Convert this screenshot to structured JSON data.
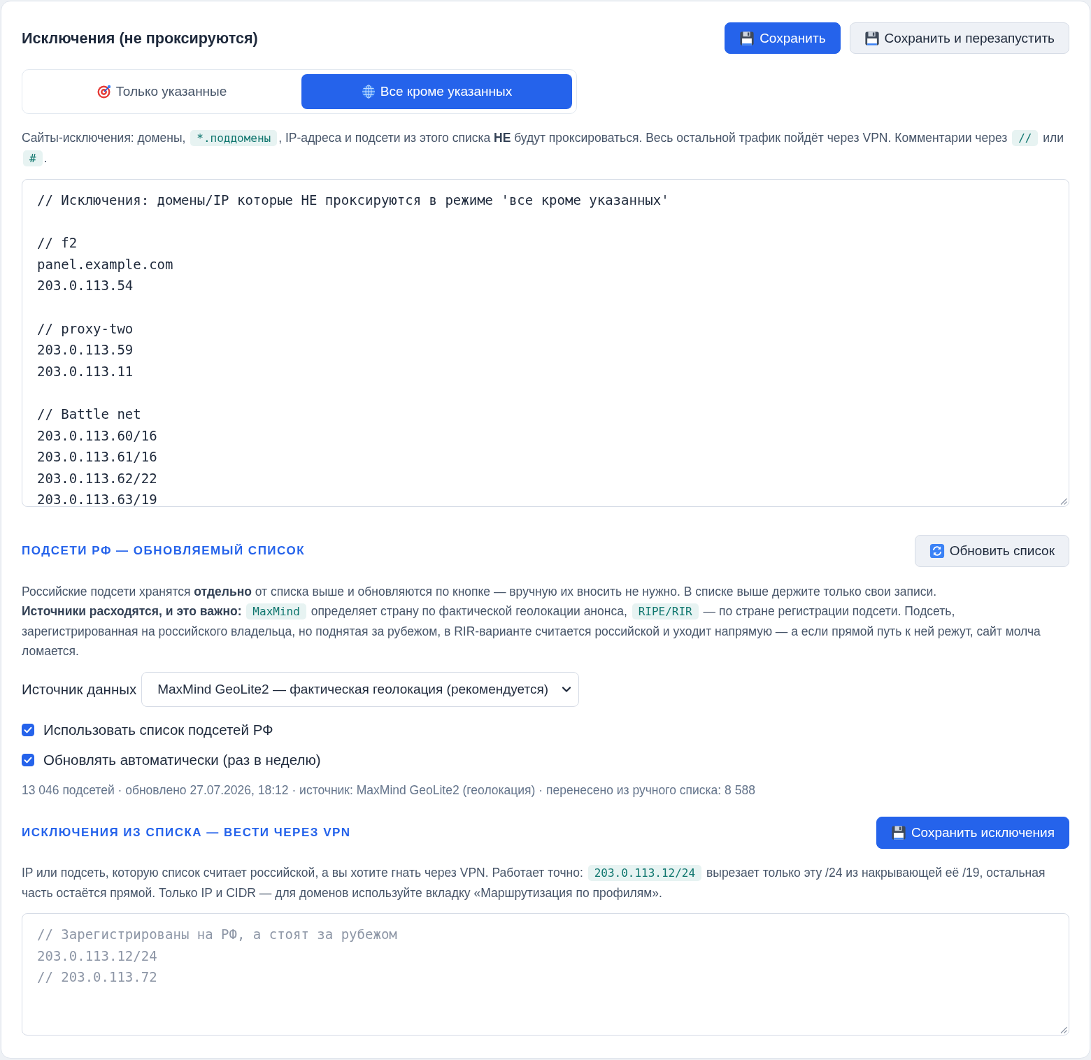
{
  "header": {
    "title": "Исключения (не проксируются)",
    "buttons": [
      {
        "label": "Сохранить",
        "kind": "primary"
      },
      {
        "label": "Сохранить и перезапустить",
        "kind": "secondary"
      }
    ]
  },
  "mode_tabs": [
    {
      "label": "Только указанные",
      "selected": false
    },
    {
      "label": "Все кроме указанных",
      "selected": true
    }
  ],
  "description": [
    {
      "kind": "text",
      "text": "Сайты-исключения: домены, "
    },
    {
      "kind": "code",
      "text": "*.поддомены"
    },
    {
      "kind": "text",
      "text": ", IP-адреса и подсети из этого списка **НЕ** будут проксироваться. Весь остальной трафик пойдёт через VPN. Комментарии через "
    },
    {
      "kind": "code",
      "text": "//"
    },
    {
      "kind": "text",
      "text": " или "
    },
    {
      "kind": "code",
      "text": "#"
    },
    {
      "kind": "text",
      "text": "."
    }
  ],
  "exclusions_editor": {
    "value": "// Исключения: домены/IP которые НЕ проксируются в режиме 'все кроме указанных'\n\n// f2\npanel.example.com\n203.0.113.54\n\n// proxy-two\n203.0.113.59\n203.0.113.11\n\n// Battle net\n203.0.113.60/16\n203.0.113.61/16\n203.0.113.62/22\n203.0.113.63/19"
  },
  "ru_subnets": {
    "heading": "ПОДСЕТИ РФ — ОБНОВЛЯЕМЫЙ СПИСОК",
    "button": {
      "label": "Обновить список",
      "kind": "secondary"
    },
    "paragraphs": [
      [
        {
          "kind": "text",
          "text": "Российские подсети хранятся **отдельно** от списка выше и обновляются по кнопке — вручную их вносить не нужно. В списке выше держите только свои записи."
        }
      ],
      [
        {
          "kind": "text",
          "text": "**Источники расходятся, и это важно:** "
        },
        {
          "kind": "code",
          "text": "MaxMind"
        },
        {
          "kind": "text",
          "text": " определяет страну по фактической геолокации анонса, "
        },
        {
          "kind": "code",
          "text": "RIPE/RIR"
        },
        {
          "kind": "text",
          "text": " — по стране регистрации подсети. Подсеть, зарегистрированная на российского владельца, но поднятая за рубежом, в RIR-варианте считается российской и уходит напрямую — а если прямой путь к ней режут, сайт молча ломается."
        }
      ]
    ],
    "source_select": {
      "label": "Источник данных",
      "value": "MaxMind GeoLite2 — фактическая геолокация (рекомендуется)"
    },
    "checkboxes": [
      {
        "label": "Использовать список подсетей РФ",
        "checked": true
      },
      {
        "label": "Обновлять автоматически (раз в неделю)",
        "checked": true
      }
    ],
    "status": "13 046 подсетей · обновлено 27.07.2026, 18:12 · источник: MaxMind GeoLite2 (геолокация) · перенесено из ручного списка: 8 588"
  },
  "vpn_exceptions": {
    "heading": "ИСКЛЮЧЕНИЯ ИЗ СПИСКА — ВЕСТИ ЧЕРЕЗ VPN",
    "button": {
      "label": "Сохранить исключения",
      "kind": "primary"
    },
    "paragraph": [
      {
        "kind": "text",
        "text": "IP или подсеть, которую список считает российской, а вы хотите гнать через VPN. Работает точно: "
      },
      {
        "kind": "code",
        "text": "203.0.113.12/24"
      },
      {
        "kind": "text",
        "text": " вырезает только эту /24 из накрывающей её /19, остальная часть остаётся прямой. Только IP и CIDR — для доменов используйте вкладку «Маршрутизация по профилям»."
      }
    ],
    "editor": {
      "placeholder": "// Зарегистрированы на РФ, а стоят за рубежом\n203.0.113.12/24\n// 203.0.113.72"
    }
  }
}
